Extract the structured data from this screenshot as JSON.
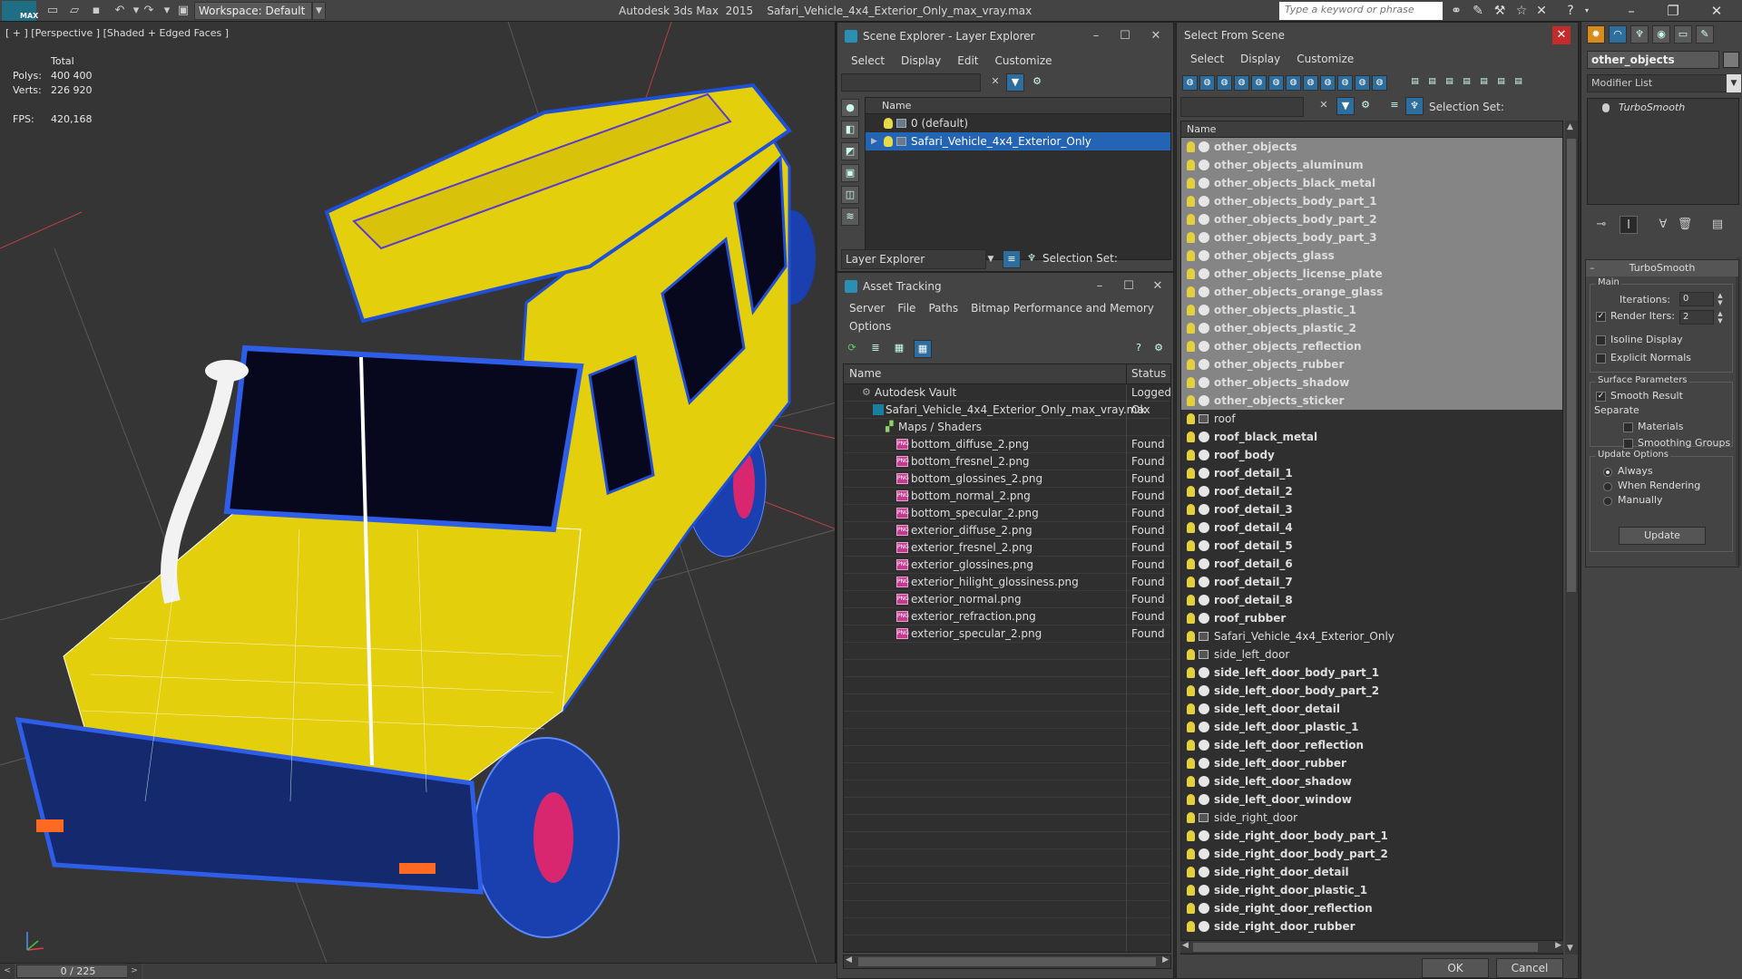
{
  "titlebar": {
    "app_logo": "MAX",
    "workspace": "Workspace: Default",
    "title": "Autodesk 3ds Max  2015    Safari_Vehicle_4x4_Exterior_Only_max_vray.max",
    "search_placeholder": "Type a keyword or phrase"
  },
  "viewport": {
    "label": "[ + ] [Perspective ] [Shaded + Edged Faces ]",
    "stats": {
      "total_label": "Total",
      "polys_label": "Polys:",
      "polys_value": "400 400",
      "verts_label": "Verts:",
      "verts_value": "226 920",
      "fps_label": "FPS:",
      "fps_value": "420,168"
    },
    "colors": {
      "body": "#e3cf0c",
      "wire": "#1f4fd6",
      "wheel": "#d8276e",
      "glass": "#07071e"
    }
  },
  "timeline": {
    "frame": "0 / 225"
  },
  "scene_explorer": {
    "title": "Scene Explorer - Layer Explorer",
    "menu": [
      "Select",
      "Display",
      "Edit",
      "Customize"
    ],
    "column_header": "Name",
    "rows": [
      "0 (default)",
      "Safari_Vehicle_4x4_Exterior_Only"
    ],
    "layer_dropdown": "Layer Explorer",
    "selection_set_label": "Selection Set:"
  },
  "asset_tracking": {
    "title": "Asset Tracking",
    "menu": [
      "Server",
      "File",
      "Paths",
      "Bitmap Performance and Memory",
      "Options"
    ],
    "columns": [
      "Name",
      "Status"
    ],
    "rows": [
      {
        "name": "Autodesk Vault",
        "status": "Logged"
      },
      {
        "name": "Safari_Vehicle_4x4_Exterior_Only_max_vray.max",
        "status": "Ok"
      },
      {
        "name": "Maps / Shaders",
        "status": ""
      },
      {
        "name": "bottom_diffuse_2.png",
        "status": "Found"
      },
      {
        "name": "bottom_fresnel_2.png",
        "status": "Found"
      },
      {
        "name": "bottom_glossines_2.png",
        "status": "Found"
      },
      {
        "name": "bottom_normal_2.png",
        "status": "Found"
      },
      {
        "name": "bottom_specular_2.png",
        "status": "Found"
      },
      {
        "name": "exterior_diffuse_2.png",
        "status": "Found"
      },
      {
        "name": "exterior_fresnel_2.png",
        "status": "Found"
      },
      {
        "name": "exterior_glossines.png",
        "status": "Found"
      },
      {
        "name": "exterior_hilight_glossiness.png",
        "status": "Found"
      },
      {
        "name": "exterior_normal.png",
        "status": "Found"
      },
      {
        "name": "exterior_refraction.png",
        "status": "Found"
      },
      {
        "name": "exterior_specular_2.png",
        "status": "Found"
      }
    ]
  },
  "select_from_scene": {
    "title": "Select From Scene",
    "menu": [
      "Select",
      "Display",
      "Customize"
    ],
    "selection_set_label": "Selection Set:",
    "column_header": "Name",
    "ok_label": "OK",
    "cancel_label": "Cancel",
    "items": [
      {
        "name": "other_objects",
        "sel": true,
        "bold": true,
        "group": false
      },
      {
        "name": "other_objects_aluminum",
        "sel": true,
        "bold": true,
        "group": false
      },
      {
        "name": "other_objects_black_metal",
        "sel": true,
        "bold": true,
        "group": false
      },
      {
        "name": "other_objects_body_part_1",
        "sel": true,
        "bold": true,
        "group": false
      },
      {
        "name": "other_objects_body_part_2",
        "sel": true,
        "bold": true,
        "group": false
      },
      {
        "name": "other_objects_body_part_3",
        "sel": true,
        "bold": true,
        "group": false
      },
      {
        "name": "other_objects_glass",
        "sel": true,
        "bold": true,
        "group": false
      },
      {
        "name": "other_objects_license_plate",
        "sel": true,
        "bold": true,
        "group": false
      },
      {
        "name": "other_objects_orange_glass",
        "sel": true,
        "bold": true,
        "group": false
      },
      {
        "name": "other_objects_plastic_1",
        "sel": true,
        "bold": true,
        "group": false
      },
      {
        "name": "other_objects_plastic_2",
        "sel": true,
        "bold": true,
        "group": false
      },
      {
        "name": "other_objects_reflection",
        "sel": true,
        "bold": true,
        "group": false
      },
      {
        "name": "other_objects_rubber",
        "sel": true,
        "bold": true,
        "group": false
      },
      {
        "name": "other_objects_shadow",
        "sel": true,
        "bold": true,
        "group": false
      },
      {
        "name": "other_objects_sticker",
        "sel": true,
        "bold": true,
        "group": false
      },
      {
        "name": "roof",
        "sel": false,
        "bold": false,
        "group": true
      },
      {
        "name": "roof_black_metal",
        "sel": false,
        "bold": true,
        "group": false
      },
      {
        "name": "roof_body",
        "sel": false,
        "bold": true,
        "group": false
      },
      {
        "name": "roof_detail_1",
        "sel": false,
        "bold": true,
        "group": false
      },
      {
        "name": "roof_detail_2",
        "sel": false,
        "bold": true,
        "group": false
      },
      {
        "name": "roof_detail_3",
        "sel": false,
        "bold": true,
        "group": false
      },
      {
        "name": "roof_detail_4",
        "sel": false,
        "bold": true,
        "group": false
      },
      {
        "name": "roof_detail_5",
        "sel": false,
        "bold": true,
        "group": false
      },
      {
        "name": "roof_detail_6",
        "sel": false,
        "bold": true,
        "group": false
      },
      {
        "name": "roof_detail_7",
        "sel": false,
        "bold": true,
        "group": false
      },
      {
        "name": "roof_detail_8",
        "sel": false,
        "bold": true,
        "group": false
      },
      {
        "name": "roof_rubber",
        "sel": false,
        "bold": true,
        "group": false
      },
      {
        "name": "Safari_Vehicle_4x4_Exterior_Only",
        "sel": false,
        "bold": false,
        "group": true
      },
      {
        "name": "side_left_door",
        "sel": false,
        "bold": false,
        "group": true
      },
      {
        "name": "side_left_door_body_part_1",
        "sel": false,
        "bold": true,
        "group": false
      },
      {
        "name": "side_left_door_body_part_2",
        "sel": false,
        "bold": true,
        "group": false
      },
      {
        "name": "side_left_door_detail",
        "sel": false,
        "bold": true,
        "group": false
      },
      {
        "name": "side_left_door_plastic_1",
        "sel": false,
        "bold": true,
        "group": false
      },
      {
        "name": "side_left_door_reflection",
        "sel": false,
        "bold": true,
        "group": false
      },
      {
        "name": "side_left_door_rubber",
        "sel": false,
        "bold": true,
        "group": false
      },
      {
        "name": "side_left_door_shadow",
        "sel": false,
        "bold": true,
        "group": false
      },
      {
        "name": "side_left_door_window",
        "sel": false,
        "bold": true,
        "group": false
      },
      {
        "name": "side_right_door",
        "sel": false,
        "bold": false,
        "group": true
      },
      {
        "name": "side_right_door_body_part_1",
        "sel": false,
        "bold": true,
        "group": false
      },
      {
        "name": "side_right_door_body_part_2",
        "sel": false,
        "bold": true,
        "group": false
      },
      {
        "name": "side_right_door_detail",
        "sel": false,
        "bold": true,
        "group": false
      },
      {
        "name": "side_right_door_plastic_1",
        "sel": false,
        "bold": true,
        "group": false
      },
      {
        "name": "side_right_door_reflection",
        "sel": false,
        "bold": true,
        "group": false
      },
      {
        "name": "side_right_door_rubber",
        "sel": false,
        "bold": true,
        "group": false
      }
    ]
  },
  "command_panel": {
    "object_name": "other_objects",
    "modifier_list": "Modifier List",
    "stack_item": "TurboSmooth",
    "turbosmooth": {
      "title": "TurboSmooth",
      "main_label": "Main",
      "iterations_label": "Iterations:",
      "iterations_value": "0",
      "render_iters_label": "Render Iters:",
      "render_iters_value": "2",
      "isoline_label": "Isoline Display",
      "explicit_normals_label": "Explicit Normals",
      "surface_params_label": "Surface Parameters",
      "smooth_result_label": "Smooth Result",
      "separate_label": "Separate",
      "materials_label": "Materials",
      "smoothing_groups_label": "Smoothing Groups",
      "update_options_label": "Update Options",
      "always_label": "Always",
      "when_rendering_label": "When Rendering",
      "manually_label": "Manually",
      "update_button": "Update"
    }
  }
}
